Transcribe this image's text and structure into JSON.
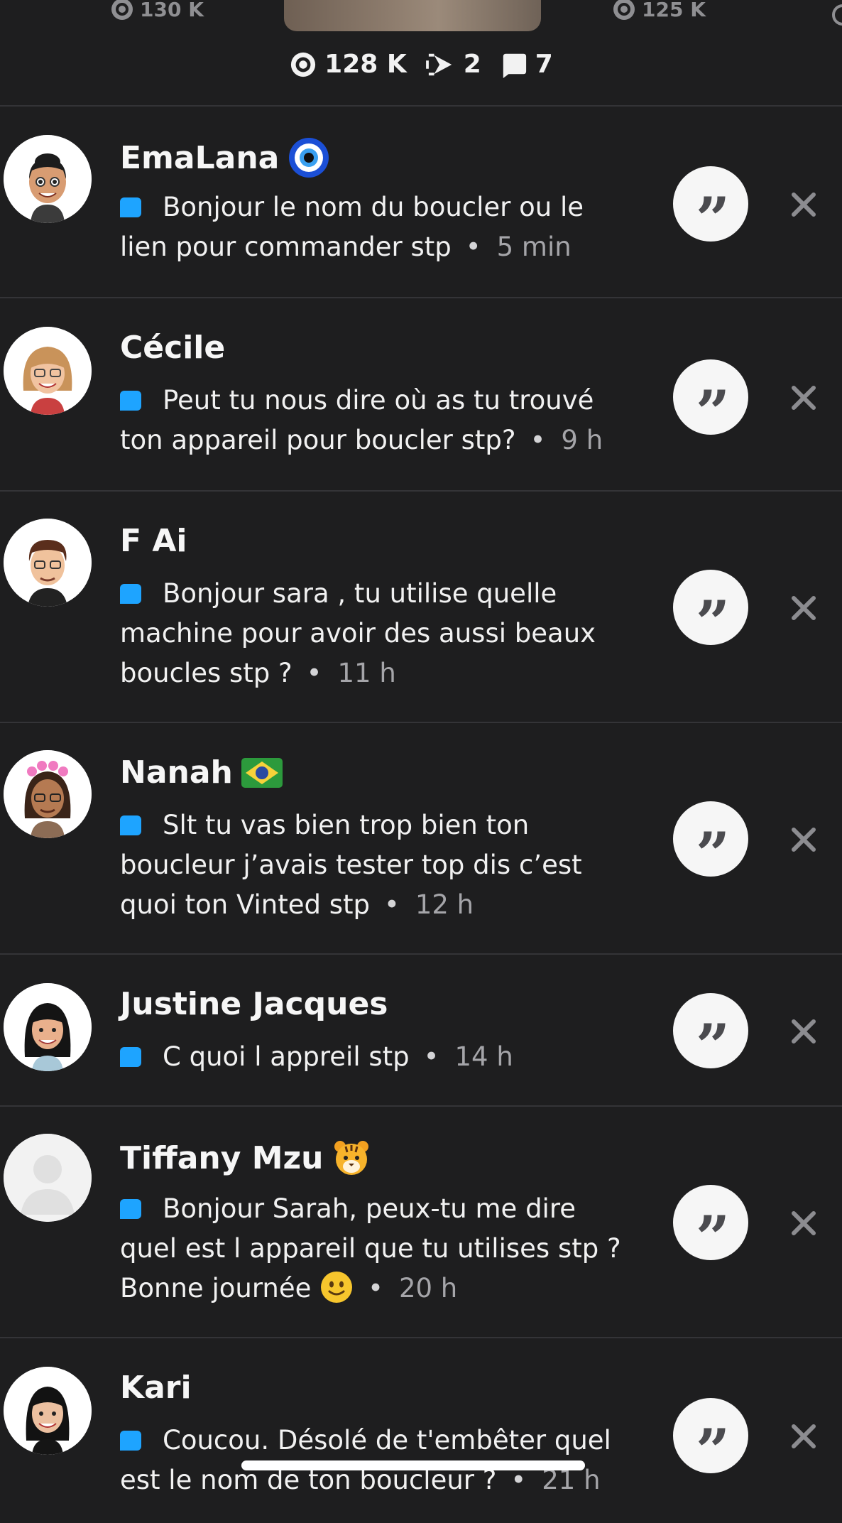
{
  "header": {
    "peek_left_views": "130 K",
    "peek_right_views": "125 K",
    "views": "128 K",
    "screenshots": "2",
    "replies": "7"
  },
  "replies": [
    {
      "name": "EmaLana",
      "emoji": "nazar-amulet",
      "message": "Bonjour le nom du boucler ou le lien pour commander stp",
      "time": "5 min"
    },
    {
      "name": "Cécile",
      "emoji": "",
      "message": "Peut tu nous dire où as tu trouvé ton appareil pour boucler stp?",
      "time": "9 h"
    },
    {
      "name": "F Ai",
      "emoji": "",
      "message": "Bonjour sara , tu utilise quelle machine pour avoir des aussi beaux boucles stp ?",
      "time": "11 h"
    },
    {
      "name": "Nanah",
      "emoji": "brazil-flag",
      "message": "Slt tu vas bien trop bien ton boucleur j’avais tester top dis c’est quoi ton Vinted stp",
      "time": "12 h"
    },
    {
      "name": "Justine Jacques",
      "emoji": "",
      "message": "C quoi l appreil stp",
      "time": "14 h"
    },
    {
      "name": "Tiffany Mzu",
      "emoji": "tiger-face",
      "message": "Bonjour Sarah, peux-tu me dire quel est l appareil que tu utilises stp ? Bonne journée",
      "message_emoji": "slightly-smiling-face",
      "time": "20 h"
    },
    {
      "name": "Kari",
      "emoji": "",
      "message": "Coucou. Désolé de t'embêter quel est le nom de ton boucleur ?",
      "time": "21 h"
    }
  ],
  "colors": {
    "background": "#1e1e1f",
    "chat_blue": "#1ea4ff",
    "quote_bg": "#f6f6f6"
  }
}
